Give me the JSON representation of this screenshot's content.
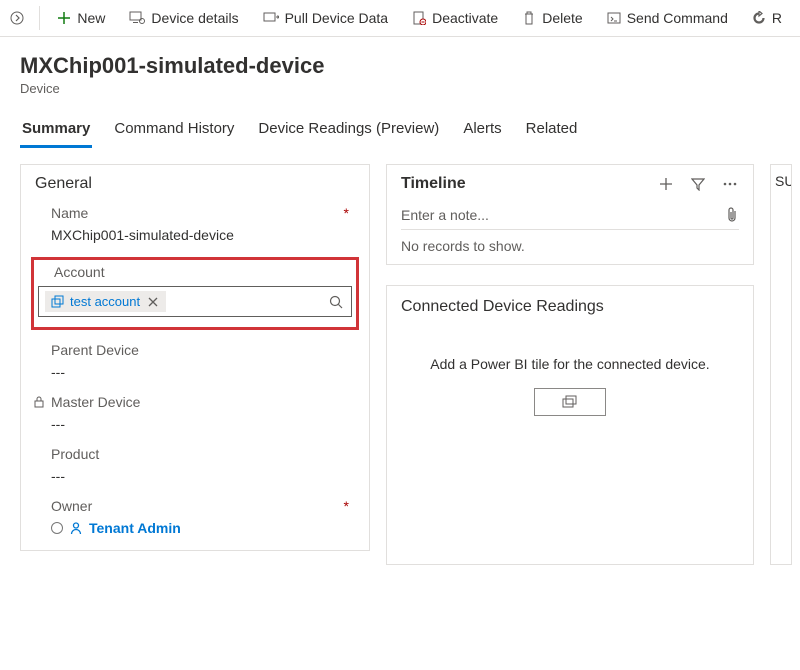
{
  "toolbar": {
    "new": "New",
    "details": "Device details",
    "pull": "Pull Device Data",
    "deactivate": "Deactivate",
    "delete": "Delete",
    "send": "Send Command",
    "refresh": "R"
  },
  "header": {
    "title": "MXChip001-simulated-device",
    "subtitle": "Device"
  },
  "tabs": {
    "summary": "Summary",
    "history": "Command History",
    "readings": "Device Readings (Preview)",
    "alerts": "Alerts",
    "related": "Related"
  },
  "general": {
    "title": "General",
    "name_label": "Name",
    "name_value": "MXChip001-simulated-device",
    "account_label": "Account",
    "account_value": "test account",
    "parent_label": "Parent Device",
    "parent_value": "---",
    "master_label": "Master Device",
    "master_value": "---",
    "product_label": "Product",
    "product_value": "---",
    "owner_label": "Owner",
    "owner_value": "Tenant Admin"
  },
  "timeline": {
    "title": "Timeline",
    "placeholder": "Enter a note...",
    "empty": "No records to show."
  },
  "connected": {
    "title": "Connected Device Readings",
    "message": "Add a Power BI tile for the connected device."
  },
  "extra": {
    "title": "SU"
  }
}
